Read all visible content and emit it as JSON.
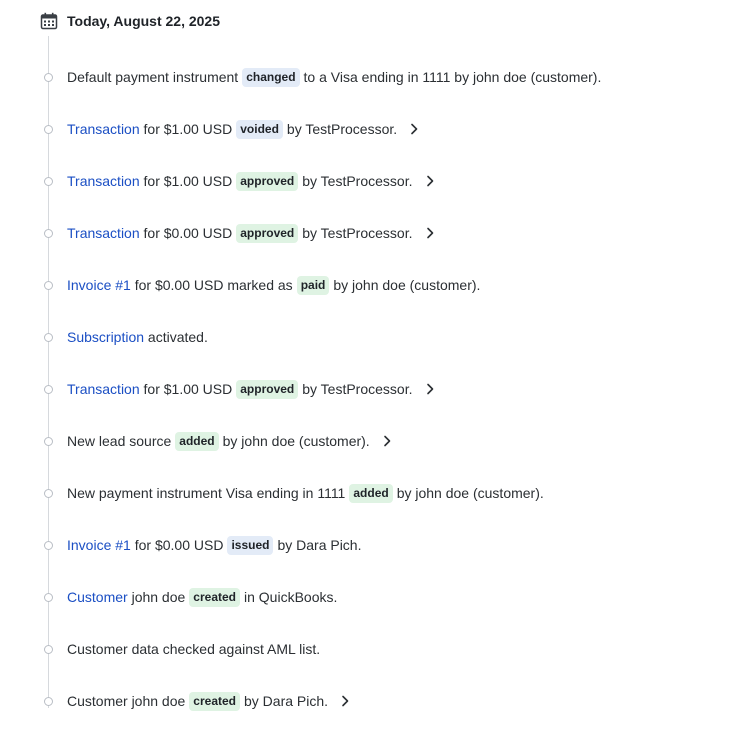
{
  "header": {
    "date": "Today, August 22, 2025"
  },
  "events": [
    {
      "parts": [
        {
          "t": "Default payment instrument "
        },
        {
          "badge": "changed",
          "color": "blue"
        },
        {
          "t": " to a Visa ending in 1111 by john doe (customer)."
        }
      ],
      "chevron": false
    },
    {
      "parts": [
        {
          "link": "Transaction"
        },
        {
          "t": " for $1.00 USD "
        },
        {
          "badge": "voided",
          "color": "blue"
        },
        {
          "t": " by TestProcessor."
        }
      ],
      "chevron": true
    },
    {
      "parts": [
        {
          "link": "Transaction"
        },
        {
          "t": " for $1.00 USD "
        },
        {
          "badge": "approved",
          "color": "green"
        },
        {
          "t": " by TestProcessor."
        }
      ],
      "chevron": true
    },
    {
      "parts": [
        {
          "link": "Transaction"
        },
        {
          "t": " for $0.00 USD "
        },
        {
          "badge": "approved",
          "color": "green"
        },
        {
          "t": " by TestProcessor."
        }
      ],
      "chevron": true
    },
    {
      "parts": [
        {
          "link": "Invoice #1"
        },
        {
          "t": " for $0.00 USD marked as "
        },
        {
          "badge": "paid",
          "color": "green"
        },
        {
          "t": " by john doe (customer)."
        }
      ],
      "chevron": false
    },
    {
      "parts": [
        {
          "link": "Subscription"
        },
        {
          "t": " activated."
        }
      ],
      "chevron": false
    },
    {
      "parts": [
        {
          "link": "Transaction"
        },
        {
          "t": " for $1.00 USD "
        },
        {
          "badge": "approved",
          "color": "green"
        },
        {
          "t": " by TestProcessor."
        }
      ],
      "chevron": true
    },
    {
      "parts": [
        {
          "t": "New lead source "
        },
        {
          "badge": "added",
          "color": "green"
        },
        {
          "t": " by john doe (customer)."
        }
      ],
      "chevron": true
    },
    {
      "parts": [
        {
          "t": "New payment instrument Visa ending in 1111 "
        },
        {
          "badge": "added",
          "color": "green"
        },
        {
          "t": " by john doe (customer)."
        }
      ],
      "chevron": false
    },
    {
      "parts": [
        {
          "link": "Invoice #1"
        },
        {
          "t": " for $0.00 USD "
        },
        {
          "badge": "issued",
          "color": "blue"
        },
        {
          "t": " by Dara Pich."
        }
      ],
      "chevron": false
    },
    {
      "parts": [
        {
          "link": "Customer"
        },
        {
          "t": " john doe "
        },
        {
          "badge": "created",
          "color": "green"
        },
        {
          "t": " in QuickBooks."
        }
      ],
      "chevron": false
    },
    {
      "parts": [
        {
          "t": "Customer data checked against AML list."
        }
      ],
      "chevron": false
    },
    {
      "parts": [
        {
          "t": "Customer john doe "
        },
        {
          "badge": "created",
          "color": "green"
        },
        {
          "t": " by Dara Pich."
        }
      ],
      "chevron": true
    }
  ]
}
